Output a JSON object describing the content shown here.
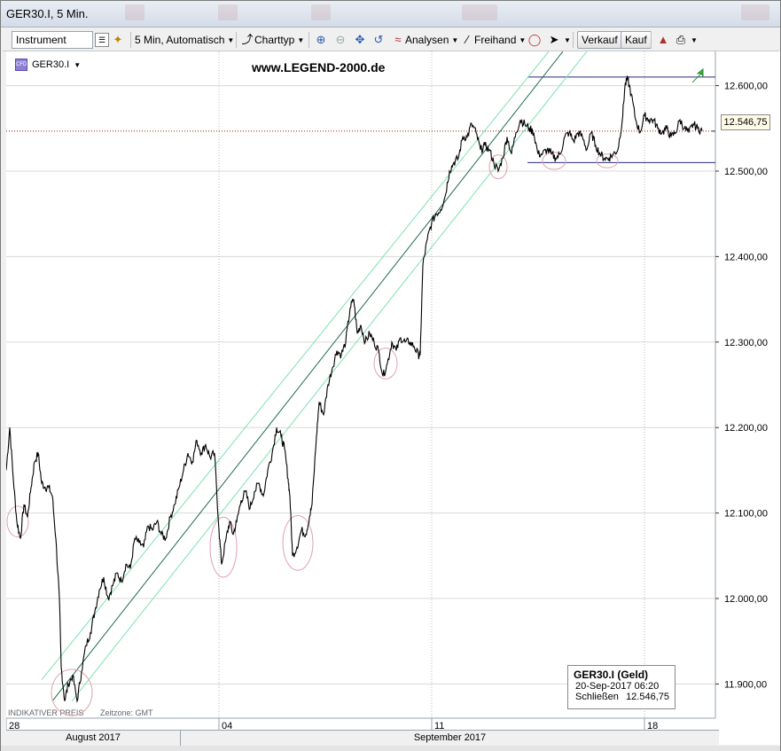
{
  "window": {
    "title": "GER30.I, 5 Min."
  },
  "toolbar": {
    "instrument_value": "Instrument",
    "interval_label": "5 Min,  Automatisch",
    "charttype_label": "Charttyp",
    "analysis_label": "Analysen",
    "freehand_label": "Freihand",
    "sell_label": "Verkauf",
    "buy_label": "Kauf"
  },
  "chart_header": {
    "symbol": "GER30.I",
    "cfd_badge": "CFD",
    "website": "www.LEGEND-2000.de"
  },
  "footer": {
    "indicative": "INDIKATIVER PREIS",
    "timezone": "Zeitzone: GMT",
    "months": [
      "August 2017",
      "September 2017"
    ]
  },
  "infobox": {
    "title": "GER30.I (Geld)",
    "datetime": "20-Sep-2017 06:20",
    "close_label": "Schließen",
    "close_value": "12.546,75"
  },
  "colors": {
    "price_line": "#000000",
    "channel_mid": "#1f6b4a",
    "channel_outer": "#7fe0b0",
    "level_line": "#2a2a7a",
    "current_price_line": "#a02020",
    "circle": "#e0a0b0",
    "grid": "#d8d8d8"
  },
  "chart_data": {
    "type": "line",
    "title": "GER30.I, 5 Min.",
    "xlabel": "",
    "ylabel": "",
    "ylim": [
      11860,
      12640
    ],
    "yticks": [
      11900,
      12000,
      12100,
      12200,
      12300,
      12400,
      12500,
      12600
    ],
    "ytick_labels": [
      "11.900,00",
      "12.000,00",
      "12.100,00",
      "12.200,00",
      "12.300,00",
      "12.400,00",
      "12.500,00",
      "12.600,00"
    ],
    "xticks": [
      {
        "x": 0,
        "label": "28"
      },
      {
        "x": 24,
        "label": "04"
      },
      {
        "x": 48,
        "label": "11"
      },
      {
        "x": 72,
        "label": "18"
      }
    ],
    "xlim": [
      0,
      80
    ],
    "grid": true,
    "current_price": 12546.75,
    "current_price_label": "12.546,75",
    "series": [
      {
        "values": [
          [
            0.0,
            12150
          ],
          [
            0.4,
            12200
          ],
          [
            0.8,
            12140
          ],
          [
            1.2,
            12090
          ],
          [
            1.6,
            12070
          ],
          [
            2.0,
            12110
          ],
          [
            2.4,
            12095
          ],
          [
            2.8,
            12130
          ],
          [
            3.2,
            12160
          ],
          [
            3.6,
            12170
          ],
          [
            4.0,
            12135
          ],
          [
            4.4,
            12130
          ],
          [
            4.8,
            12130
          ],
          [
            5.2,
            12120
          ],
          [
            5.6,
            12070
          ],
          [
            6.0,
            12000
          ],
          [
            6.2,
            11920
          ],
          [
            6.6,
            11880
          ],
          [
            7.0,
            11900
          ],
          [
            7.5,
            11910
          ],
          [
            8.0,
            11880
          ],
          [
            8.5,
            11915
          ],
          [
            9.0,
            11945
          ],
          [
            9.5,
            11960
          ],
          [
            10.0,
            11985
          ],
          [
            10.5,
            12010
          ],
          [
            11.0,
            12025
          ],
          [
            11.5,
            12000
          ],
          [
            12.0,
            12015
          ],
          [
            12.5,
            12030
          ],
          [
            13.0,
            12020
          ],
          [
            13.5,
            12040
          ],
          [
            14.0,
            12035
          ],
          [
            14.5,
            12070
          ],
          [
            15.0,
            12065
          ],
          [
            15.5,
            12060
          ],
          [
            16.0,
            12085
          ],
          [
            16.5,
            12080
          ],
          [
            17.0,
            12090
          ],
          [
            17.5,
            12075
          ],
          [
            18.0,
            12070
          ],
          [
            18.5,
            12095
          ],
          [
            19.0,
            12110
          ],
          [
            19.5,
            12130
          ],
          [
            20.0,
            12150
          ],
          [
            20.5,
            12170
          ],
          [
            21.0,
            12160
          ],
          [
            21.5,
            12185
          ],
          [
            22.0,
            12170
          ],
          [
            22.5,
            12180
          ],
          [
            23.0,
            12165
          ],
          [
            23.5,
            12170
          ],
          [
            24.0,
            12080
          ],
          [
            24.3,
            12040
          ],
          [
            24.8,
            12070
          ],
          [
            25.2,
            12090
          ],
          [
            25.6,
            12075
          ],
          [
            26.0,
            12090
          ],
          [
            26.5,
            12115
          ],
          [
            27.0,
            12125
          ],
          [
            27.5,
            12105
          ],
          [
            28.0,
            12125
          ],
          [
            28.5,
            12135
          ],
          [
            29.0,
            12120
          ],
          [
            29.5,
            12150
          ],
          [
            30.0,
            12170
          ],
          [
            30.5,
            12200
          ],
          [
            31.0,
            12190
          ],
          [
            31.4,
            12175
          ],
          [
            31.8,
            12140
          ],
          [
            32.0,
            12120
          ],
          [
            32.3,
            12050
          ],
          [
            32.8,
            12060
          ],
          [
            33.3,
            12080
          ],
          [
            33.8,
            12075
          ],
          [
            34.2,
            12095
          ],
          [
            34.5,
            12110
          ],
          [
            35.0,
            12190
          ],
          [
            35.3,
            12230
          ],
          [
            35.8,
            12215
          ],
          [
            36.3,
            12250
          ],
          [
            36.8,
            12270
          ],
          [
            37.3,
            12290
          ],
          [
            37.8,
            12285
          ],
          [
            38.3,
            12300
          ],
          [
            38.8,
            12340
          ],
          [
            39.2,
            12350
          ],
          [
            39.6,
            12310
          ],
          [
            40.0,
            12320
          ],
          [
            40.5,
            12300
          ],
          [
            41.0,
            12310
          ],
          [
            41.5,
            12300
          ],
          [
            42.0,
            12290
          ],
          [
            42.5,
            12260
          ],
          [
            43.0,
            12275
          ],
          [
            43.5,
            12300
          ],
          [
            44.0,
            12290
          ],
          [
            44.5,
            12305
          ],
          [
            45.0,
            12300
          ],
          [
            45.5,
            12300
          ],
          [
            46.0,
            12295
          ],
          [
            46.5,
            12285
          ],
          [
            46.7,
            12285
          ],
          [
            47.0,
            12390
          ],
          [
            47.5,
            12420
          ],
          [
            48.0,
            12440
          ],
          [
            48.5,
            12450
          ],
          [
            49.0,
            12455
          ],
          [
            49.5,
            12470
          ],
          [
            50.0,
            12500
          ],
          [
            50.5,
            12510
          ],
          [
            51.0,
            12515
          ],
          [
            51.5,
            12540
          ],
          [
            52.0,
            12540
          ],
          [
            52.5,
            12555
          ],
          [
            53.0,
            12545
          ],
          [
            53.5,
            12525
          ],
          [
            54.0,
            12530
          ],
          [
            54.5,
            12525
          ],
          [
            55.0,
            12510
          ],
          [
            55.5,
            12500
          ],
          [
            56.0,
            12515
          ],
          [
            56.5,
            12540
          ],
          [
            57.0,
            12520
          ],
          [
            57.5,
            12545
          ],
          [
            58.0,
            12560
          ],
          [
            58.5,
            12555
          ],
          [
            59.0,
            12550
          ],
          [
            59.5,
            12545
          ],
          [
            60.0,
            12520
          ],
          [
            60.5,
            12520
          ],
          [
            61.0,
            12525
          ],
          [
            61.5,
            12520
          ],
          [
            62.0,
            12515
          ],
          [
            62.5,
            12520
          ],
          [
            63.0,
            12540
          ],
          [
            63.5,
            12545
          ],
          [
            64.0,
            12535
          ],
          [
            64.5,
            12545
          ],
          [
            65.0,
            12540
          ],
          [
            65.5,
            12525
          ],
          [
            66.0,
            12545
          ],
          [
            66.5,
            12530
          ],
          [
            67.0,
            12520
          ],
          [
            67.5,
            12515
          ],
          [
            68.0,
            12515
          ],
          [
            68.5,
            12520
          ],
          [
            69.0,
            12525
          ],
          [
            69.5,
            12560
          ],
          [
            69.8,
            12600
          ],
          [
            70.1,
            12608
          ],
          [
            70.5,
            12590
          ],
          [
            71.0,
            12560
          ],
          [
            71.5,
            12545
          ],
          [
            72.0,
            12565
          ],
          [
            72.5,
            12560
          ],
          [
            73.0,
            12560
          ],
          [
            73.5,
            12550
          ],
          [
            74.0,
            12545
          ],
          [
            74.5,
            12550
          ],
          [
            75.0,
            12540
          ],
          [
            75.5,
            12545
          ],
          [
            76.0,
            12560
          ],
          [
            76.5,
            12550
          ],
          [
            77.0,
            12545
          ],
          [
            77.5,
            12555
          ],
          [
            78.0,
            12550
          ],
          [
            78.5,
            12547
          ]
        ]
      }
    ],
    "channel": {
      "mid": [
        [
          5.2,
          11880
        ],
        [
          62.8,
          12640
        ]
      ],
      "upper": [
        [
          4.0,
          11905
        ],
        [
          61.2,
          12640
        ]
      ],
      "lower": [
        [
          7.4,
          11880
        ],
        [
          65.5,
          12640
        ]
      ]
    },
    "levels": [
      12510,
      12610
    ],
    "circles": [
      {
        "x": 1.3,
        "y": 12090,
        "rx": 1.2,
        "ry": 18
      },
      {
        "x": 7.4,
        "y": 11890,
        "rx": 2.3,
        "ry": 27
      },
      {
        "x": 24.5,
        "y": 12060,
        "rx": 1.5,
        "ry": 35
      },
      {
        "x": 32.9,
        "y": 12065,
        "rx": 1.7,
        "ry": 32
      },
      {
        "x": 42.8,
        "y": 12275,
        "rx": 1.3,
        "ry": 18
      },
      {
        "x": 55.5,
        "y": 12505,
        "rx": 1.0,
        "ry": 14
      },
      {
        "x": 61.8,
        "y": 12512,
        "rx": 1.3,
        "ry": 10
      },
      {
        "x": 67.8,
        "y": 12512,
        "rx": 1.2,
        "ry": 8
      }
    ]
  }
}
